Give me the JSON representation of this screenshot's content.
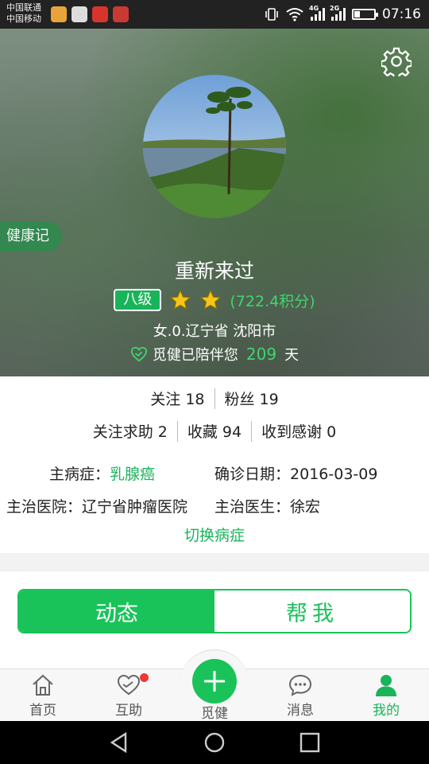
{
  "status_bar": {
    "carrier1": "中国联通",
    "carrier2": "中国移动",
    "net1": "4G",
    "net2": "2G",
    "time": "07:16"
  },
  "profile": {
    "side_tag": "健康记",
    "username": "重新来过",
    "level": "八级",
    "points": "(722.4积分)",
    "location": "女.0.辽宁省 沈阳市",
    "companion_prefix": "觅健已陪伴您",
    "companion_days": "209",
    "companion_suffix": "天"
  },
  "stats": {
    "follow": "关注 18",
    "fans": "粉丝 19",
    "help_follow": "关注求助 2",
    "favorites": "收藏 94",
    "thanks": "收到感谢 0"
  },
  "diagnosis": {
    "disease_label": "主病症：",
    "disease": "乳腺癌",
    "date_label": "确诊日期：",
    "date": "2016-03-09",
    "hospital_label": "主治医院：",
    "hospital": "辽宁省肿瘤医院",
    "doctor_label": "主治医生：",
    "doctor": "徐宏",
    "switch": "切换病症"
  },
  "segment": {
    "active": "动态",
    "inactive": "帮我"
  },
  "tabs": {
    "home": "首页",
    "mutual": "互助",
    "mijian": "觅健",
    "messages": "消息",
    "mine": "我的"
  },
  "colors": {
    "accent": "#19c35a",
    "star": "#f5c518",
    "badge_dot": "#e93a3a"
  }
}
